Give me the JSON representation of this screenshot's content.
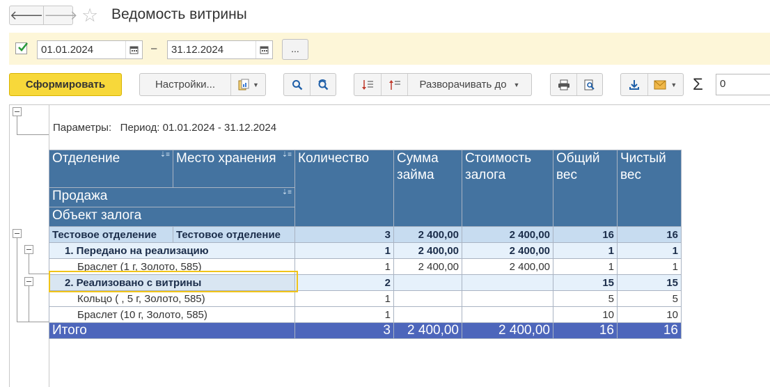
{
  "window": {
    "title": "Ведомость витрины",
    "back_icon": "arrow-left-icon",
    "forward_icon": "arrow-right-icon"
  },
  "period": {
    "enabled": true,
    "date_from": "01.01.2024",
    "separator": "–",
    "date_to": "31.12.2024",
    "more_label": "..."
  },
  "toolbar": {
    "generate_label": "Сформировать",
    "settings_label": "Настройки...",
    "expand_label": "Разворачивать до",
    "sum_value": "0"
  },
  "report": {
    "params_label": "Параметры:",
    "params_value": "Период: 01.01.2024 - 31.12.2024",
    "headers": {
      "department": "Отделение",
      "storage": "Место хранения",
      "sale": "Продажа",
      "pledge_object": "Объект залога",
      "quantity": "Количество",
      "loan_sum": "Сумма займа",
      "pledge_cost": "Стоимость залога",
      "total_weight": "Общий вес",
      "net_weight": "Чистый вес"
    },
    "dept_row": {
      "department": "Тестовое отделение",
      "storage": "Тестовое отделение",
      "qty": "3",
      "loan": "2 400,00",
      "cost": "2 400,00",
      "gross": "16",
      "net": "16"
    },
    "group1": {
      "label": "1. Передано на реализацию",
      "qty": "1",
      "loan": "2 400,00",
      "cost": "2 400,00",
      "gross": "1",
      "net": "1"
    },
    "item1": {
      "label": "Браслет (1 г, Золото, 585)",
      "qty": "1",
      "loan": "2 400,00",
      "cost": "2 400,00",
      "gross": "1",
      "net": "1"
    },
    "group2": {
      "label": "2. Реализовано с витрины",
      "qty": "2",
      "loan": "",
      "cost": "",
      "gross": "15",
      "net": "15"
    },
    "item2": {
      "label": "Кольцо ( , 5 г, Золото, 585)",
      "qty": "1",
      "loan": "",
      "cost": "",
      "gross": "5",
      "net": "5"
    },
    "item3": {
      "label": "Браслет (10 г, Золото, 585)",
      "qty": "1",
      "loan": "",
      "cost": "",
      "gross": "10",
      "net": "10"
    },
    "total": {
      "label": "Итого",
      "qty": "3",
      "loan": "2 400,00",
      "cost": "2 400,00",
      "gross": "16",
      "net": "16"
    }
  }
}
